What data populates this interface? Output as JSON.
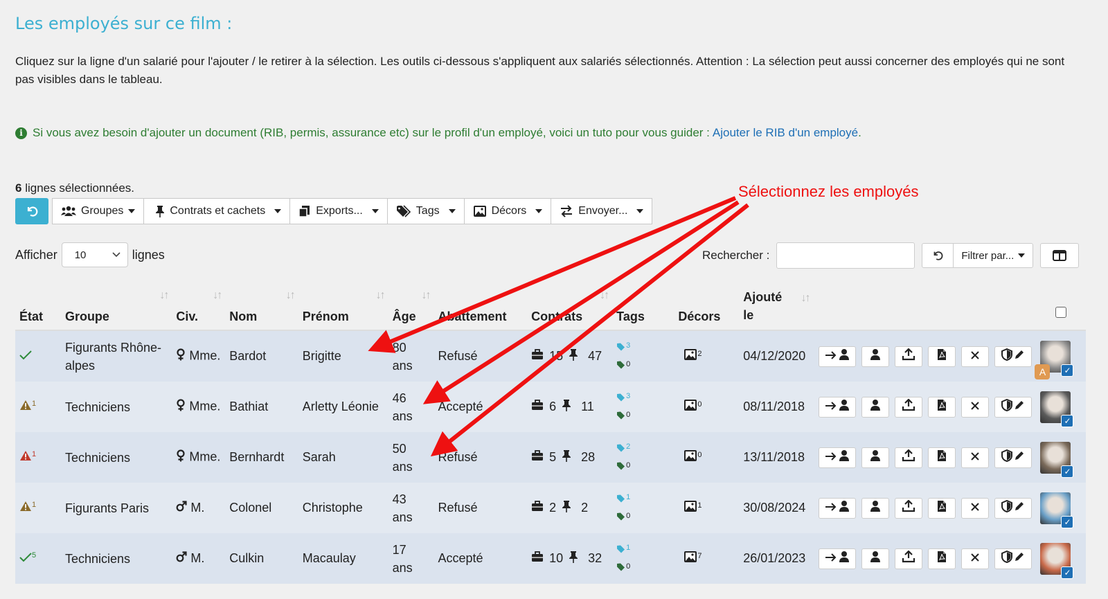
{
  "page": {
    "title": "Les employés sur ce film :",
    "intro": "Cliquez sur la ligne d'un salarié pour l'ajouter / le retirer à la sélection. Les outils ci-dessous s'appliquent aux salariés sélectionnés. Attention : La sélection peut aussi concerner des employés qui ne sont pas visibles dans le tableau.",
    "info_text": "Si vous avez besoin d'ajouter un document (RIB, permis, assurance etc) sur le profil d'un employé, voici un tuto pour vous guider : ",
    "info_link": "Ajouter le RIB d'un employé",
    "info_end": "."
  },
  "selection": {
    "count": "6",
    "label": " lignes sélectionnées."
  },
  "toolbar": {
    "groupes": "Groupes",
    "contrats": "Contrats et cachets",
    "exports": "Exports...",
    "tags": "Tags",
    "decors": "Décors",
    "envoyer": "Envoyer..."
  },
  "controls": {
    "afficher": "Afficher",
    "page_size": "10",
    "lignes": "lignes",
    "rechercher": "Rechercher :",
    "filtrer": "Filtrer par..."
  },
  "table": {
    "headers": {
      "etat": "État",
      "groupe": "Groupe",
      "civ": "Civ.",
      "nom": "Nom",
      "prenom": "Prénom",
      "age": "Âge",
      "abattement": "Abattement",
      "contrats": "Contrats",
      "tags": "Tags",
      "decors": "Décors",
      "ajoute": "Ajouté le"
    },
    "rows": [
      {
        "etat": "ok",
        "etat_count": "",
        "groupe": "Figurants Rhône-alpes",
        "civ": "Mme.",
        "sex": "f",
        "nom": "Bardot",
        "prenom": "Brigitte",
        "age": "80 ans",
        "abattement": "Refusé",
        "contrats": "15",
        "cachets": "47",
        "tag1": "3",
        "tag2": "0",
        "decors": "2",
        "ajoute": "04/12/2020",
        "badge": "A",
        "avatar_color": "#8a8a8a"
      },
      {
        "etat": "warn",
        "etat_count": "1",
        "groupe": "Techniciens",
        "civ": "Mme.",
        "sex": "f",
        "nom": "Bathiat",
        "prenom": "Arletty Léonie",
        "age": "46 ans",
        "abattement": "Accepté",
        "contrats": "6",
        "cachets": "11",
        "tag1": "3",
        "tag2": "0",
        "decors": "0",
        "ajoute": "08/11/2018",
        "badge": "",
        "avatar_color": "#5a5a5a"
      },
      {
        "etat": "danger",
        "etat_count": "1",
        "groupe": "Techniciens",
        "civ": "Mme.",
        "sex": "f",
        "nom": "Bernhardt",
        "prenom": "Sarah",
        "age": "50 ans",
        "abattement": "Refusé",
        "contrats": "5",
        "cachets": "28",
        "tag1": "2",
        "tag2": "0",
        "decors": "0",
        "ajoute": "13/11/2018",
        "badge": "",
        "avatar_color": "#7a6a5a"
      },
      {
        "etat": "warn",
        "etat_count": "1",
        "groupe": "Figurants Paris",
        "civ": "M.",
        "sex": "m",
        "nom": "Colonel",
        "prenom": "Christophe",
        "age": "43 ans",
        "abattement": "Refusé",
        "contrats": "2",
        "cachets": "2",
        "tag1": "1",
        "tag2": "0",
        "decors": "1",
        "ajoute": "30/08/2024",
        "badge": "",
        "avatar_color": "#6aa0c8"
      },
      {
        "etat": "ok",
        "etat_count": "5",
        "groupe": "Techniciens",
        "civ": "M.",
        "sex": "m",
        "nom": "Culkin",
        "prenom": "Macaulay",
        "age": "17 ans",
        "abattement": "Accepté",
        "contrats": "10",
        "cachets": "32",
        "tag1": "1",
        "tag2": "0",
        "decors": "7",
        "ajoute": "26/01/2023",
        "badge": "",
        "avatar_color": "#c96a4a"
      }
    ]
  },
  "annotation": {
    "text": "Sélectionnez les employés",
    "color": "#e11111"
  },
  "colors": {
    "accent": "#3cb0d1",
    "ok": "#2e8b3a",
    "warn": "#8a6a2a",
    "danger": "#c0392b",
    "link": "#1e6fb5"
  }
}
